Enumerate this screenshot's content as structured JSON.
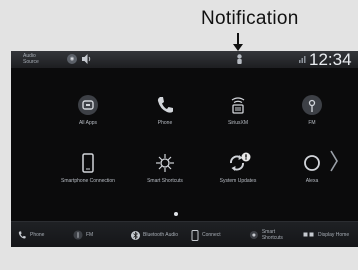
{
  "callout": {
    "label": "Notification"
  },
  "status_bar": {
    "audio_source": "Audio Source",
    "time": "12:34",
    "icons": [
      "home-circle-icon",
      "speaker-icon",
      "notification-icon",
      "signal-icon"
    ]
  },
  "apps": [
    {
      "label": "All Apps",
      "icon": "grid-icon"
    },
    {
      "label": "Phone",
      "icon": "phone-icon"
    },
    {
      "label": "SiriusXM",
      "icon": "satellite-radio-icon"
    },
    {
      "label": "FM",
      "icon": "fm-radio-icon"
    },
    {
      "label": "Smartphone Connection",
      "icon": "smartphone-icon"
    },
    {
      "label": "Smart Shortcuts",
      "icon": "smart-shortcuts-icon"
    },
    {
      "label": "System Updates",
      "icon": "update-icon",
      "badge": "!"
    },
    {
      "label": "Alexa",
      "icon": "alexa-icon"
    }
  ],
  "bottom_bar": [
    {
      "label": "Phone",
      "icon": "phone-icon"
    },
    {
      "label": "FM",
      "icon": "fm-radio-icon"
    },
    {
      "label": "Bluetooth Audio",
      "icon": "bluetooth-icon"
    },
    {
      "label": "Connect",
      "icon": "connect-icon"
    },
    {
      "label": "Smart Shortcuts",
      "icon": "smart-shortcuts-icon"
    },
    {
      "label": "Display Home",
      "icon": "display-home-icon"
    }
  ],
  "colors": {
    "screen_bg": "#0b0b0c",
    "icon_tile": "#3d4046",
    "text": "#b9bec6",
    "alert": "#e8e8e8"
  }
}
